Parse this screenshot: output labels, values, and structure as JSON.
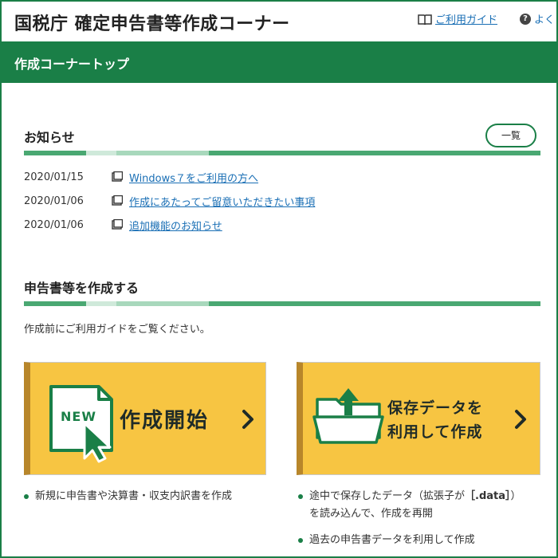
{
  "header": {
    "title": "国税庁 確定申告書等作成コーナー",
    "guide_link": "ご利用ガイド",
    "faq_link": "よく"
  },
  "nav": {
    "title": "作成コーナートップ"
  },
  "notices": {
    "title": "お知らせ",
    "list_button": "一覧",
    "items": [
      {
        "date": "2020/01/15",
        "text": "Windows７をご利用の方へ"
      },
      {
        "date": "2020/01/06",
        "text": "作成にあたってご留意いただきたい事項"
      },
      {
        "date": "2020/01/06",
        "text": "追加機能のお知らせ"
      }
    ]
  },
  "create": {
    "title": "申告書等を作成する",
    "guide_text": "作成前にご利用ガイドをご覧ください。",
    "start_button": {
      "label": "作成開始",
      "badge": "NEW",
      "bullets": [
        "新規に申告書や決算書・収支内訳書を作成"
      ]
    },
    "saved_button": {
      "label_line1": "保存データを",
      "label_line2": "利用して作成",
      "bullet1_pre": "途中で保存したデータ（拡張子が",
      "bullet1_ext": "［.data］",
      "bullet1_post": "）",
      "bullet1_line2": "を読み込んで、作成を再開",
      "bullet2": "過去の申告書データを利用して作成"
    }
  },
  "colors": {
    "brand_green": "#1a7f47",
    "button_yellow": "#f7c542",
    "link_blue": "#1a6fb5"
  }
}
